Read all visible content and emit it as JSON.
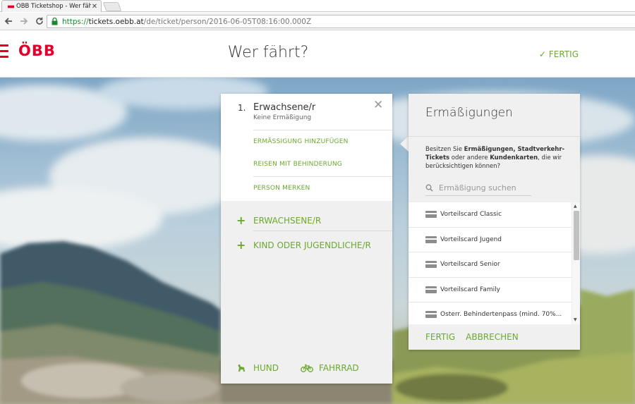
{
  "browser": {
    "tab_title": "ÖBB Ticketshop - Wer fähr",
    "url_scheme": "https://",
    "url_host": "tickets.oebb.at",
    "url_path": "/de/ticket/person/2016-06-05T08:16:00.000Z"
  },
  "header": {
    "logo_text": "ÖBB",
    "title": "Wer fährt?",
    "done_label": "FERTIG"
  },
  "traveller": {
    "index": "1.",
    "type": "Erwachsene/r",
    "discount": "Keine Ermäßigung",
    "links": [
      "ERMÄSSIGUNG HINZUFÜGEN",
      "REISEN MIT BEHINDERUNG",
      "PERSON MERKEN"
    ]
  },
  "add_options": [
    "ERWACHSENE/R",
    "KIND ODER JUGENDLICHE/R"
  ],
  "extras": {
    "dog": "HUND",
    "bike": "FAHRRAD"
  },
  "discounts": {
    "title": "Ermäßigungen",
    "desc_1": "Besitzen Sie ",
    "desc_2": "Ermäßigungen, Stadtverkehr-Tickets",
    "desc_3": " oder andere ",
    "desc_4": "Kundenkarten",
    "desc_5": ", die wir berücksichtigen können?",
    "search_placeholder": "Ermäßigung suchen",
    "items": [
      "Vorteilscard Classic",
      "Vorteilscard Jugend",
      "Vorteilscard Senior",
      "Vorteilscard Family",
      "Österr. Behindertenpass (mind. 70%..."
    ],
    "done_label": "FERTIG",
    "cancel_label": "ABBRECHEN"
  },
  "colors": {
    "brand_red": "#e2002a",
    "accent_green": "#6aa92d"
  }
}
